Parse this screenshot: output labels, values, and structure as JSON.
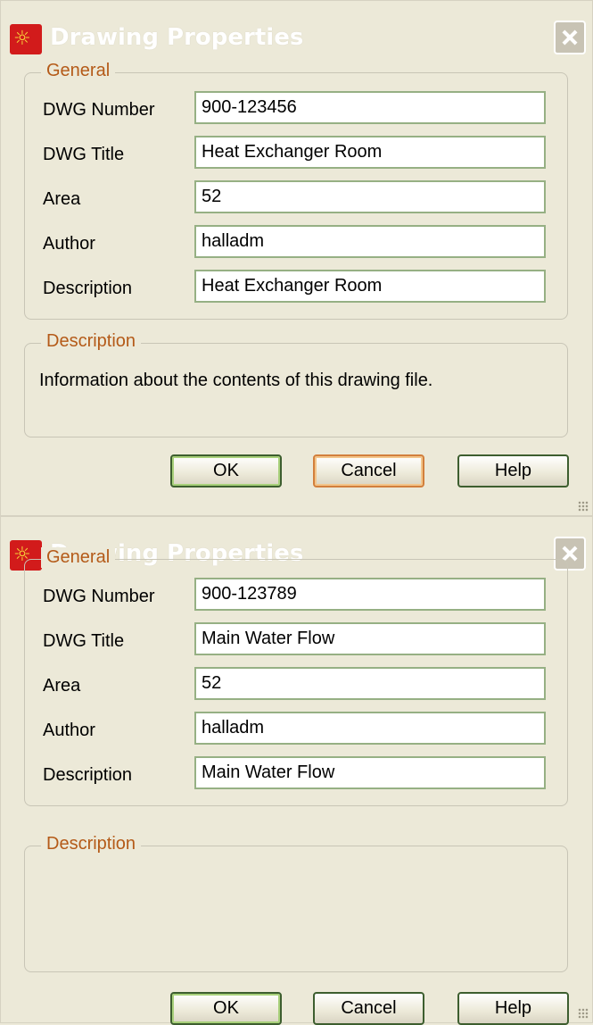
{
  "dialogs": [
    {
      "title": "Drawing Properties",
      "general_legend": "General",
      "fields": [
        {
          "label": "DWG Number",
          "value": "900-123456"
        },
        {
          "label": "DWG Title",
          "value": "Heat Exchanger Room"
        },
        {
          "label": "Area",
          "value": "52"
        },
        {
          "label": "Author",
          "value": "halladm"
        },
        {
          "label": "Description",
          "value": "Heat Exchanger Room"
        }
      ],
      "description_legend": "Description",
      "description_text": "Information about the contents of this drawing file.",
      "buttons": {
        "ok": "OK",
        "cancel": "Cancel",
        "help": "Help"
      }
    },
    {
      "title": "Drawing Properties",
      "general_legend": "General",
      "fields": [
        {
          "label": "DWG Number",
          "value": "900-123789"
        },
        {
          "label": "DWG Title",
          "value": "Main Water Flow"
        },
        {
          "label": "Area",
          "value": "52"
        },
        {
          "label": "Author",
          "value": "halladm"
        },
        {
          "label": "Description",
          "value": "Main Water Flow"
        }
      ],
      "description_legend": "Description",
      "description_text": "",
      "buttons": {
        "ok": "OK",
        "cancel": "Cancel",
        "help": "Help"
      }
    }
  ],
  "colors": {
    "legend": "#b45a18",
    "window_bg": "#ece9d8",
    "field_border": "#96b084"
  },
  "icons": {
    "app": "app-logo-icon",
    "close": "close-icon",
    "grip": "resize-grip-icon"
  }
}
